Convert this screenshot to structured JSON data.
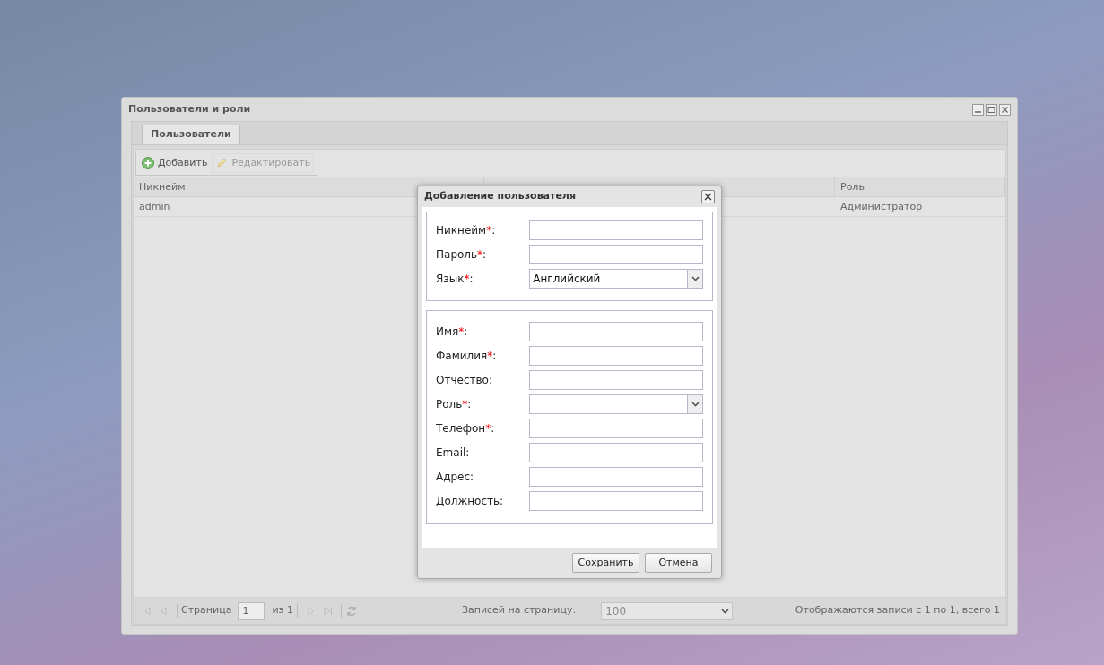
{
  "window": {
    "title": "Пользователи и роли"
  },
  "tabs": [
    {
      "label": "Пользователи",
      "selected": true
    }
  ],
  "toolbar": [
    {
      "label": "Добавить",
      "kind": "add",
      "disabled": false
    },
    {
      "label": "Редактировать",
      "kind": "edit",
      "disabled": true
    }
  ],
  "table": {
    "columns": [
      "Никнейм",
      "",
      "Роль"
    ],
    "rows": [
      [
        "admin",
        "",
        "Администратор"
      ]
    ]
  },
  "paging": {
    "page_label": "Страница",
    "page": "1",
    "of": "из 1",
    "per_page_label": "Записей на страницу:",
    "per_page": "100",
    "summary": "Отображаются записи с 1 по 1, всего 1"
  },
  "dialog": {
    "title": "Добавление пользователя",
    "sections": [
      [
        {
          "label": "Никнейм",
          "required_mark": "*",
          "suffix": ":",
          "kind": "text"
        },
        {
          "label": "Пароль",
          "required_mark": "*",
          "suffix": ":",
          "kind": "text"
        },
        {
          "label": "Язык",
          "required_mark": "*",
          "suffix": ":",
          "kind": "combo",
          "value": "Английский"
        }
      ],
      [
        {
          "label": "Имя",
          "required_mark": "*",
          "suffix": ":",
          "kind": "text"
        },
        {
          "label": "Фамилия",
          "required_mark": "*",
          "suffix": ":",
          "kind": "text"
        },
        {
          "label": "Отчество",
          "suffix": ":",
          "kind": "text"
        },
        {
          "label": "Роль",
          "required_mark": "*",
          "suffix": ":",
          "kind": "combo"
        },
        {
          "label": "Телефон",
          "required_mark": "*",
          "suffix": ":",
          "kind": "text"
        },
        {
          "label": "Email",
          "suffix": ":",
          "kind": "text"
        },
        {
          "label": "Адрес",
          "suffix": ":",
          "kind": "text"
        },
        {
          "label": "Должность",
          "suffix": ":",
          "kind": "text"
        }
      ]
    ],
    "buttons": [
      "Сохранить",
      "Отмена"
    ]
  }
}
